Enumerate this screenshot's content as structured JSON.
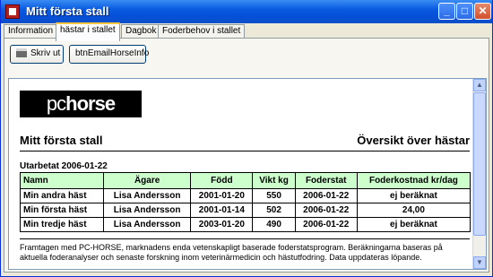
{
  "window": {
    "title": "Mitt första stall"
  },
  "titlebar_buttons": {
    "minimize": "_",
    "maximize": "□",
    "close": "✕"
  },
  "tabs": [
    {
      "label": "Information"
    },
    {
      "label": "hästar i stallet"
    },
    {
      "label": "Dagbok"
    },
    {
      "label": "Foderbehov i stallet"
    }
  ],
  "toolbar": {
    "print_label": "Skriv ut",
    "email_label": "btnEmailHorseInfo"
  },
  "report": {
    "logo_prefix": "pc",
    "logo_suffix": "horse",
    "title": "Mitt första stall",
    "subtitle": "Översikt över hästar",
    "printed": "Utarbetat 2006-01-22",
    "columns": [
      "Namn",
      "Ägare",
      "Född",
      "Vikt kg",
      "Foderstat",
      "Foderkostnad kr/dag"
    ],
    "rows": [
      [
        "Min andra häst",
        "Lisa Andersson",
        "2001-01-20",
        "550",
        "2006-01-22",
        "ej beräknat"
      ],
      [
        "Min första häst",
        "Lisa Andersson",
        "2001-01-14",
        "502",
        "2006-01-22",
        "24,00"
      ],
      [
        "Min tredje häst",
        "Lisa Andersson",
        "2003-01-20",
        "490",
        "2006-01-22",
        "ej beräknat"
      ]
    ],
    "footnote": "Framtagen med PC-HORSE, marknadens enda vetenskapligt baserade foderstatsprogram. Beräkningarna baseras på aktuella foderanalyser och senaste forskning inom veterinärmedicin och hästutfodring. Data uppdateras löpande."
  },
  "scrollbar": {
    "up_arrow": "▲",
    "down_arrow": "▼"
  }
}
